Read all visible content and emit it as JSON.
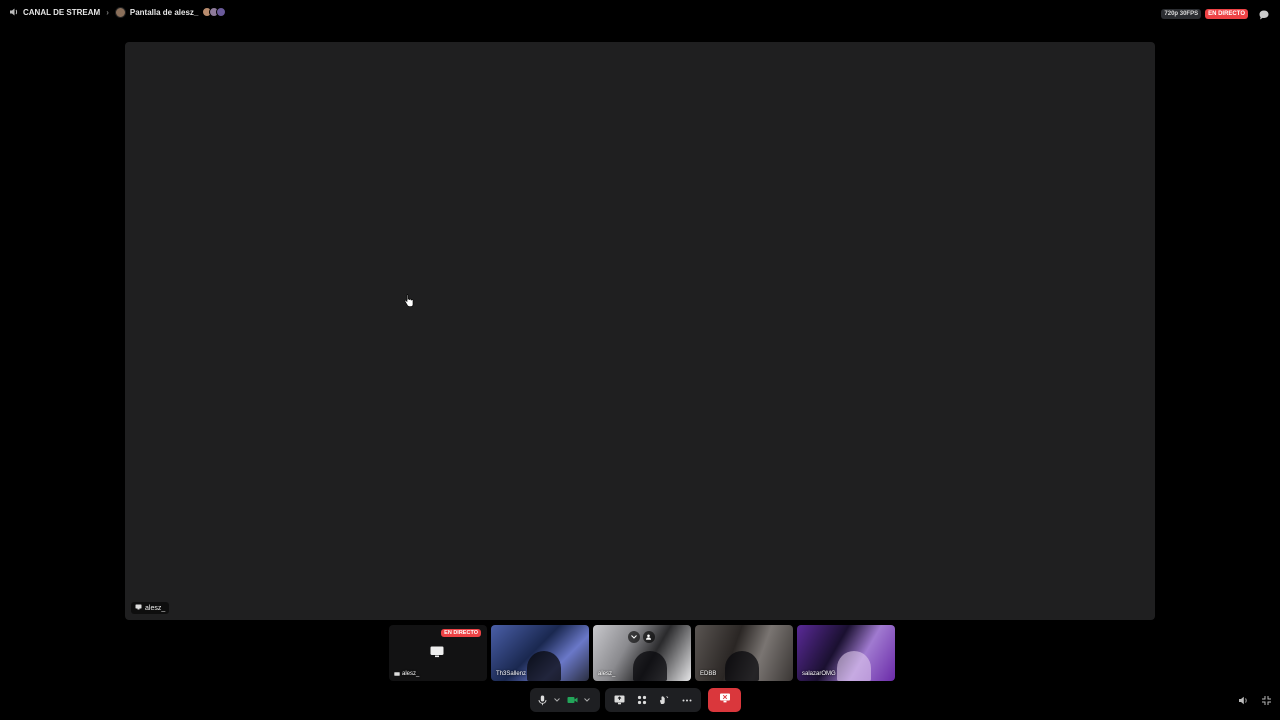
{
  "topbar": {
    "channel_name": "CANAL DE STREAM",
    "stream_title": "Pantalla de alesz_",
    "quality": "720p 30FPS",
    "live_badge": "EN DIRECTO"
  },
  "stage": {
    "streamer_label": "alesz_"
  },
  "tiles": [
    {
      "name": "alesz_",
      "badge": "EN DIRECTO",
      "type": "stream"
    },
    {
      "name": "Th3Sallenz",
      "type": "camera"
    },
    {
      "name": "alesz_",
      "type": "camera"
    },
    {
      "name": "EDBB",
      "type": "camera"
    },
    {
      "name": "salazarOMG",
      "type": "camera"
    }
  ],
  "controls": {
    "mic": "microphone-icon",
    "camera": "camera-icon",
    "share": "screen-share-icon",
    "activities": "activities-icon",
    "soundboard": "soundboard-icon",
    "more": "more-icon",
    "disconnect": "disconnect-icon"
  },
  "colors": {
    "live_red": "#ed4245",
    "stage_bg": "#1f1f20",
    "camera_on_green": "#23a55a",
    "disconnect_red": "#da373c"
  }
}
